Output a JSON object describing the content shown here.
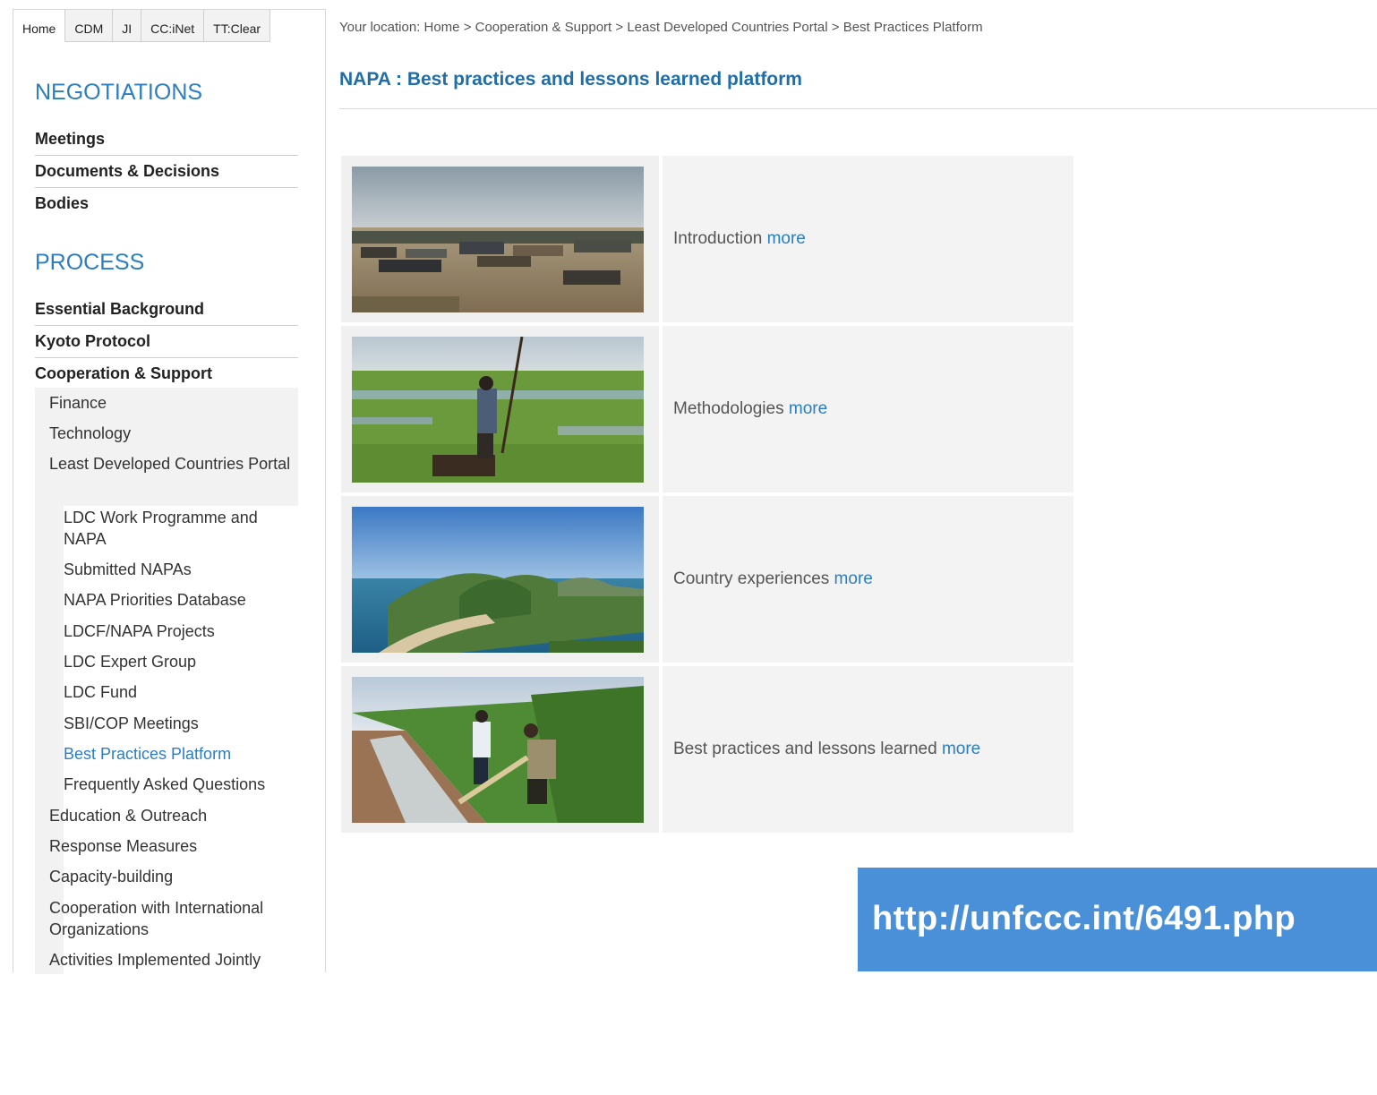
{
  "tabs": [
    "Home",
    "CDM",
    "JI",
    "CC:iNet",
    "TT:Clear"
  ],
  "sidebar": {
    "negotiations_heading": "NEGOTIATIONS",
    "negotiations_items": [
      "Meetings",
      "Documents & Decisions",
      "Bodies"
    ],
    "process_heading": "PROCESS",
    "process_items": [
      "Essential Background",
      "Kyoto Protocol",
      "Cooperation & Support"
    ],
    "coop_items": [
      "Finance",
      "Technology",
      "Least Developed Countries Portal"
    ],
    "ldc_items": [
      "LDC Work Programme and NAPA",
      "Submitted NAPAs",
      "NAPA Priorities Database",
      "LDCF/NAPA Projects",
      "LDC Expert Group",
      "LDC Fund",
      "SBI/COP Meetings",
      "Best Practices Platform",
      "Frequently Asked Questions"
    ],
    "more_items": [
      "Education & Outreach",
      "Response Measures",
      "Capacity-building",
      "Cooperation with International Organizations",
      "Activities Implemented Jointly"
    ]
  },
  "breadcrumb": "Your location: Home > Cooperation & Support > Least Developed Countries Portal > Best Practices Platform",
  "page_title": "NAPA : Best practices and lessons learned platform",
  "cards": [
    {
      "label": "Introduction",
      "link": "more",
      "image": "floating-village-photo"
    },
    {
      "label": "Methodologies",
      "link": "more",
      "image": "wetland-boatman-photo"
    },
    {
      "label": "Country experiences",
      "link": "more",
      "image": "coastal-hills-photo"
    },
    {
      "label": "Best practices and lessons learned",
      "link": "more",
      "image": "irrigation-canal-photo"
    }
  ],
  "url_banner": "http://unfccc.int/6491.php",
  "colors": {
    "accent": "#2b7ec1",
    "banner": "#4a90d9",
    "panel": "#f3f3f3"
  }
}
